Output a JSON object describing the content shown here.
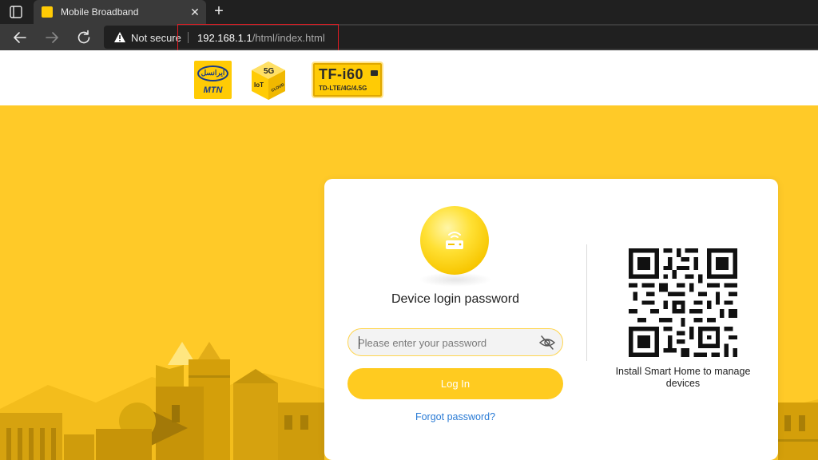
{
  "browser": {
    "tab_title": "Mobile Broadband",
    "tab_close_glyph": "✕",
    "new_tab_glyph": "+",
    "security_label": "Not secure",
    "url_host": "192.168.1.1",
    "url_path": "/html/index.html",
    "icons": [
      "tab-actions-icon",
      "back-arrow-icon",
      "forward-arrow-icon",
      "reload-icon",
      "warning-icon",
      "close-icon"
    ]
  },
  "header": {
    "logo_mtn_fa": "ایرانسل",
    "logo_mtn_en": "MTN",
    "logo_5g_text": "5G",
    "logo_5g_iot": "IoT",
    "logo_5g_cloud": "CLOUD",
    "logo_tf_model": "TF-i60",
    "logo_tf_sub": "TD-LTE/4G/4.5G"
  },
  "login": {
    "title": "Device login password",
    "password_placeholder": "Please enter your password",
    "password_value": "",
    "login_label": "Log In",
    "forgot_label": "Forgot password?"
  },
  "qr": {
    "caption": "Install Smart Home to manage devices"
  },
  "colors": {
    "brand_yellow": "#ffca28",
    "button_yellow": "#ffcb20",
    "link_blue": "#2a7bd5",
    "highlight_red": "#e31b23"
  }
}
